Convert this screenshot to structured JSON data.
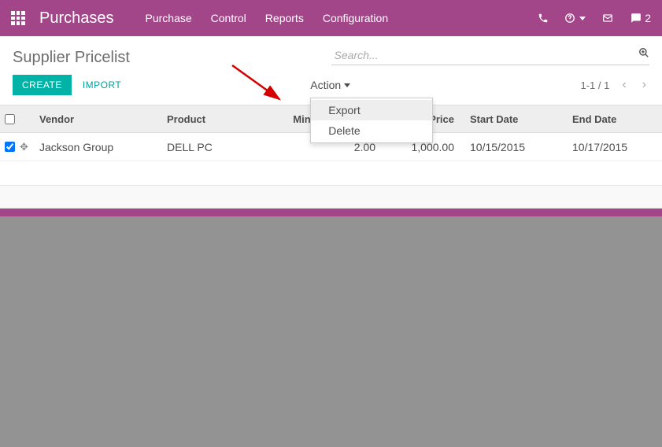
{
  "topbar": {
    "app_title": "Purchases",
    "menu": [
      "Purchase",
      "Control",
      "Reports",
      "Configuration"
    ],
    "messages_count": "2"
  },
  "header": {
    "breadcrumb": "Supplier Pricelist",
    "search_placeholder": "Search..."
  },
  "controls": {
    "create_label": "CREATE",
    "import_label": "IMPORT",
    "action_label": "Action",
    "dropdown": {
      "export": "Export",
      "delete": "Delete"
    },
    "pager": "1-1 / 1"
  },
  "table": {
    "headers": {
      "vendor": "Vendor",
      "product": "Product",
      "min_qty": "Minimal Quantity",
      "price": "Price",
      "start": "Start Date",
      "end": "End Date"
    },
    "rows": [
      {
        "vendor": "Jackson Group",
        "product": "DELL PC",
        "min_qty": "2.00",
        "price": "1,000.00",
        "start": "10/15/2015",
        "end": "10/17/2015"
      }
    ]
  }
}
